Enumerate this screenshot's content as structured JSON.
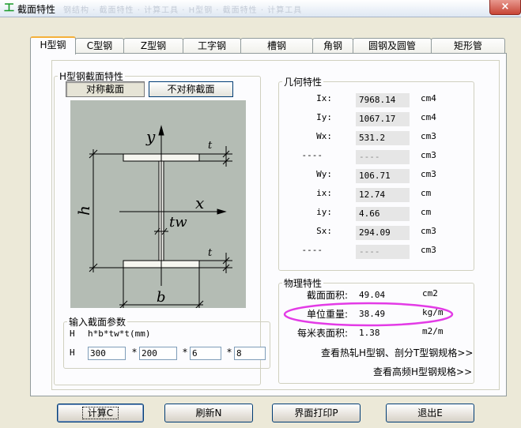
{
  "window": {
    "title": "截面特性",
    "title_blur": "钢结构 · 截面特性 · 计算工具 · H型钢 · 截面特性 · 计算工具",
    "close": "×",
    "app_icon": "工"
  },
  "tabs": [
    "H型钢",
    "C型钢",
    "Z型钢",
    "工字钢",
    "槽钢",
    "角钢",
    "圆钢及圆管",
    "矩形管"
  ],
  "section_group": {
    "legend": "H型钢截面特性",
    "symmetric": "对称截面",
    "asymmetric": "不对称截面"
  },
  "diagram": {
    "y": "y",
    "x": "x",
    "h": "h",
    "b": "b",
    "tw": "tw",
    "t": "t"
  },
  "geometry": {
    "legend": "几何特性",
    "rows": [
      {
        "label": "Ix:",
        "value": "7968.14",
        "unit": "cm4"
      },
      {
        "label": "Iy:",
        "value": "1067.17",
        "unit": "cm4"
      },
      {
        "label": "Wx:",
        "value": "531.2",
        "unit": "cm3"
      },
      {
        "label": "----",
        "value": "----",
        "unit": "cm3"
      },
      {
        "label": "Wy:",
        "value": "106.71",
        "unit": "cm3"
      },
      {
        "label": "ix:",
        "value": "12.74",
        "unit": "cm"
      },
      {
        "label": "iy:",
        "value": "4.66",
        "unit": "cm"
      },
      {
        "label": "Sx:",
        "value": "294.09",
        "unit": "cm3"
      },
      {
        "label": "----",
        "value": "----",
        "unit": "cm3"
      }
    ]
  },
  "physical": {
    "legend": "物理特性",
    "rows": [
      {
        "label": "截面面积:",
        "value": "49.04",
        "unit": "cm2"
      },
      {
        "label": "单位重量:",
        "value": "38.49",
        "unit": "kg/m"
      },
      {
        "label": "每米表面积:",
        "value": "1.38",
        "unit": "m2/m"
      }
    ],
    "link1": "查看热轧H型钢、剖分T型钢规格>>",
    "link2": "查看高频H型钢规格>>",
    "highlight_color": "#e33be6"
  },
  "params": {
    "legend": "输入截面参数",
    "h_label": "H",
    "formula": "h*b*tw*t(mm)",
    "row_label": "H",
    "star": "*",
    "h": "300",
    "b": "200",
    "tw": "6",
    "t": "8"
  },
  "buttons": {
    "calc": "计算C",
    "refresh": "刷新N",
    "print": "界面打印P",
    "exit": "退出E"
  }
}
